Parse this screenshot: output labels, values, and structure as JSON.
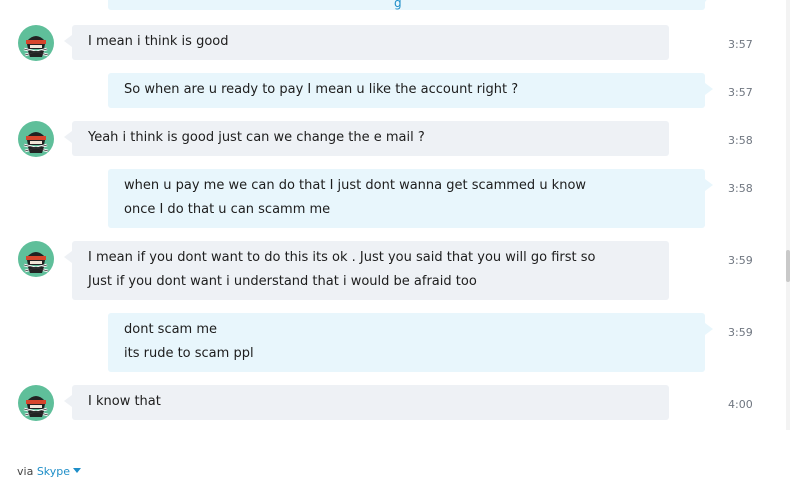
{
  "top_fragment": "g",
  "messages": [
    {
      "direction": "in",
      "lines": [
        "I mean i think is good"
      ],
      "time": "3:57"
    },
    {
      "direction": "out",
      "lines": [
        "So when are u ready to pay I mean u like the account right ?"
      ],
      "time": "3:57"
    },
    {
      "direction": "in",
      "lines": [
        "Yeah i think is good just can we change the e mail ?"
      ],
      "time": "3:58"
    },
    {
      "direction": "out",
      "lines": [
        "when u pay me we can do that I just dont wanna get scammed u know",
        "once I do that u can scamm me"
      ],
      "time": "3:58"
    },
    {
      "direction": "in",
      "lines": [
        "I mean if you dont want to do this its ok . Just you said that you will go first so",
        "Just if you dont want i understand that i would be afraid too"
      ],
      "time": "3:59"
    },
    {
      "direction": "out",
      "lines": [
        "dont scam me",
        "its rude to scam ppl"
      ],
      "time": "3:59"
    },
    {
      "direction": "in",
      "lines": [
        "I know that"
      ],
      "time": "4:00"
    }
  ],
  "footer": {
    "via": "via",
    "service": "Skype"
  },
  "colors": {
    "incoming_bubble": "#eef1f5",
    "outgoing_bubble": "#e8f6fc",
    "link": "#1e8ec8",
    "avatar_bg": "#5fbf9a"
  },
  "icons": {
    "avatar": "ninja-avatar-icon",
    "dropdown": "caret-down-icon"
  }
}
